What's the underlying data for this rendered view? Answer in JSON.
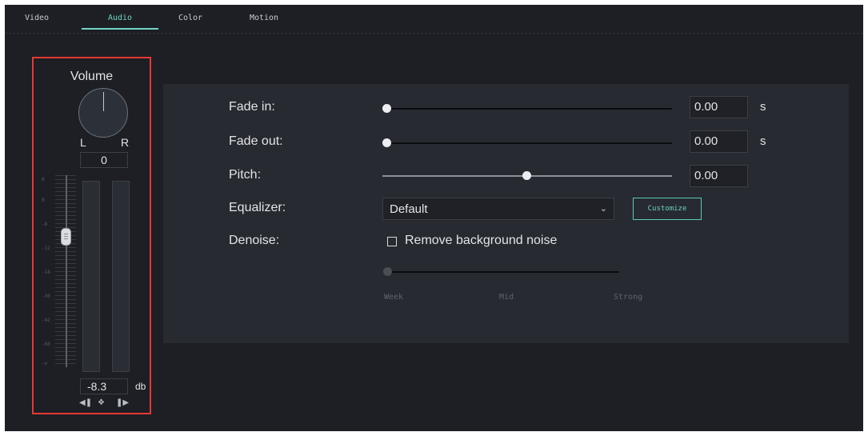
{
  "tabs": [
    "Video",
    "Audio",
    "Color",
    "Motion"
  ],
  "active_tab": "Audio",
  "volume": {
    "title": "Volume",
    "left_label": "L",
    "right_label": "R",
    "pan_value": "0",
    "db_scale": [
      "6",
      "0",
      "-6",
      "-12",
      "-18",
      "-30",
      "-42",
      "-60",
      "-∞"
    ],
    "value": "-8.3",
    "unit": "db",
    "controls": {
      "prev_icon": "prev-keyframe-icon",
      "keyframe_icon": "keyframe-icon",
      "next_icon": "next-keyframe-icon"
    }
  },
  "settings": {
    "fade_in": {
      "label": "Fade in:",
      "value": "0.00",
      "unit": "s",
      "slider_fraction": 0.0
    },
    "fade_out": {
      "label": "Fade out:",
      "value": "0.00",
      "unit": "s",
      "slider_fraction": 0.0
    },
    "pitch": {
      "label": "Pitch:",
      "value": "0.00",
      "slider_fraction": 0.5
    },
    "equalizer": {
      "label": "Equalizer:",
      "value": "Default",
      "customize_label": "Customize"
    },
    "denoise": {
      "label": "Denoise:",
      "checkbox_label": "Remove background noise",
      "checked": false,
      "strength_labels": [
        "Week",
        "Mid",
        "Strong"
      ]
    }
  },
  "colors": {
    "accent": "#6fd3c3",
    "highlight_border": "#e53935",
    "background": "#1d1f24",
    "panel": "#272a30"
  }
}
